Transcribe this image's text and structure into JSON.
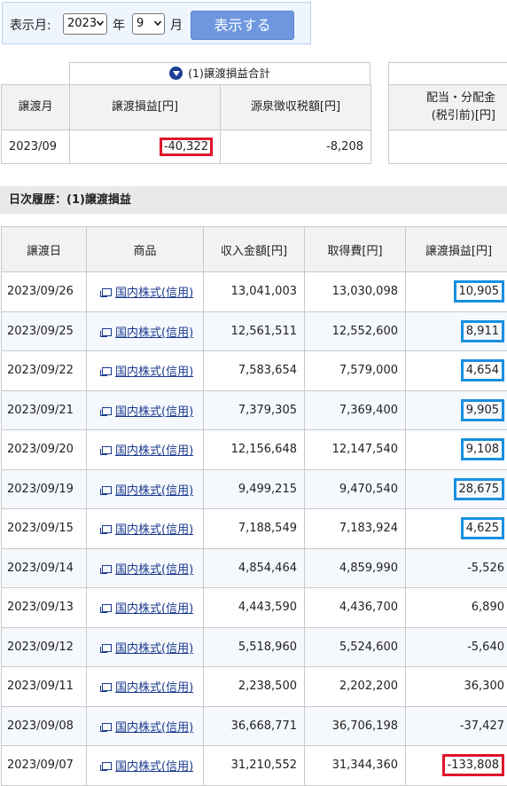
{
  "form": {
    "display_month_label": "表示月:",
    "year_value": "2023",
    "year_unit": "年",
    "month_value": "9",
    "month_unit": "月",
    "show_button": "表示する"
  },
  "summary": {
    "group_title": "(1)譲渡損益合計",
    "headers": {
      "month": "譲渡月",
      "gain_loss": "譲渡損益[円]",
      "withholding_tax": "源泉徴収税額[円]",
      "dividend_line1": "配当・分配金",
      "dividend_line2": "(税引前)[円]"
    },
    "row": {
      "month": "2023/09",
      "gain_loss": "-40,322",
      "withholding_tax": "-8,208"
    }
  },
  "history": {
    "title": "日次履歴：(1)譲渡損益",
    "headers": [
      "譲渡日",
      "商品",
      "収入金額[円]",
      "取得費[円]",
      "譲渡損益[円]"
    ],
    "rows": [
      {
        "date": "2023/09/26",
        "product": "国内株式(信用)",
        "income": "13,041,003",
        "cost": "13,030,098",
        "gain": "10,905",
        "hl": "blue"
      },
      {
        "date": "2023/09/25",
        "product": "国内株式(信用)",
        "income": "12,561,511",
        "cost": "12,552,600",
        "gain": "8,911",
        "hl": "blue"
      },
      {
        "date": "2023/09/22",
        "product": "国内株式(信用)",
        "income": "7,583,654",
        "cost": "7,579,000",
        "gain": "4,654",
        "hl": "blue"
      },
      {
        "date": "2023/09/21",
        "product": "国内株式(信用)",
        "income": "7,379,305",
        "cost": "7,369,400",
        "gain": "9,905",
        "hl": "blue"
      },
      {
        "date": "2023/09/20",
        "product": "国内株式(信用)",
        "income": "12,156,648",
        "cost": "12,147,540",
        "gain": "9,108",
        "hl": "blue"
      },
      {
        "date": "2023/09/19",
        "product": "国内株式(信用)",
        "income": "9,499,215",
        "cost": "9,470,540",
        "gain": "28,675",
        "hl": "blue"
      },
      {
        "date": "2023/09/15",
        "product": "国内株式(信用)",
        "income": "7,188,549",
        "cost": "7,183,924",
        "gain": "4,625",
        "hl": "blue"
      },
      {
        "date": "2023/09/14",
        "product": "国内株式(信用)",
        "income": "4,854,464",
        "cost": "4,859,990",
        "gain": "-5,526",
        "hl": ""
      },
      {
        "date": "2023/09/13",
        "product": "国内株式(信用)",
        "income": "4,443,590",
        "cost": "4,436,700",
        "gain": "6,890",
        "hl": ""
      },
      {
        "date": "2023/09/12",
        "product": "国内株式(信用)",
        "income": "5,518,960",
        "cost": "5,524,600",
        "gain": "-5,640",
        "hl": ""
      },
      {
        "date": "2023/09/11",
        "product": "国内株式(信用)",
        "income": "2,238,500",
        "cost": "2,202,200",
        "gain": "36,300",
        "hl": ""
      },
      {
        "date": "2023/09/08",
        "product": "国内株式(信用)",
        "income": "36,668,771",
        "cost": "36,706,198",
        "gain": "-37,427",
        "hl": ""
      },
      {
        "date": "2023/09/07",
        "product": "国内株式(信用)",
        "income": "31,210,552",
        "cost": "31,344,360",
        "gain": "-133,808",
        "hl": "red"
      }
    ]
  },
  "colors": {
    "highlight_blue": "#1890e0",
    "highlight_red": "#e0152a",
    "button_bg": "#6f97df",
    "link": "#1a3a8f"
  }
}
